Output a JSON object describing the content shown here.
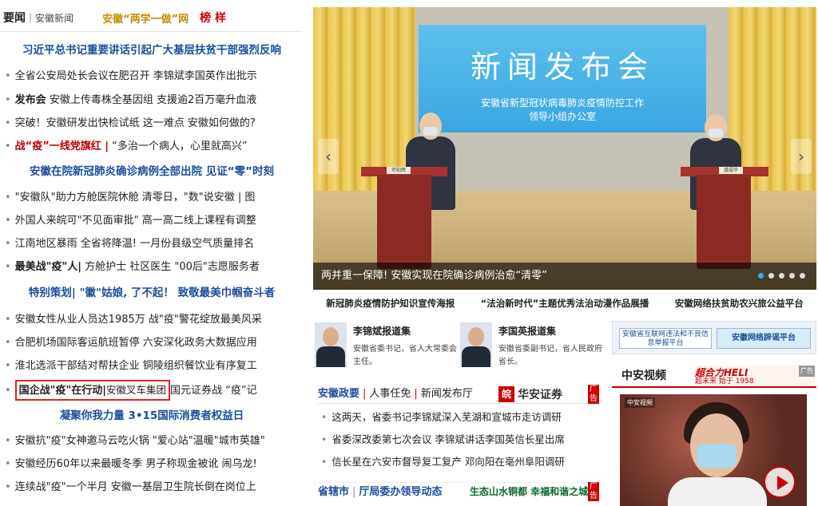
{
  "tabs": {
    "active": "要闻",
    "separator": "|",
    "second": "安徽新闻",
    "promo": "安徽“两学一做”网",
    "promo2": "榜 样"
  },
  "left": {
    "h1": "习近平总书记重要讲话引起广大基层扶贫干部强烈反响",
    "r1": "全省公安局处长会议在肥召开 李锦斌李国英作出批示",
    "r2_bold": "发布会",
    "r2_rest": " 安徽上传毒株全基因组 支援逾2百万毫升血液",
    "r3": "突破！安徽研发出快检试纸 这一难点 安徽如何做的?",
    "r4_red": "战“疫”一线党旗红 |",
    "r4_rest": " “多治一个病人，心里就高兴”",
    "h2": "安徽在院新冠肺炎确诊病例全部出院 见证“零”时刻",
    "r5": "\"安徽队\"助力方舱医院休舱 清零日，\"数\"说安徽 | 图",
    "r6": "外国人来皖可\"不见面审批\" 高一高二线上课程有调整",
    "r7": "江南地区暴雨 全省将降温! 一月份县级空气质量排名",
    "r8_bold": "最美战\"疫\"人|",
    "r8_rest": " 方舱护士 社区医生 \"00后\"志愿服务者",
    "h3": "特别策划| \"徽\"姑娘, 了不起！ 致敬最美巾帼奋斗者",
    "r9": "安徽女性从业人员达1985万 战\"疫\"警花绽放最美风采",
    "r10": "合肥机场国际客运航班暂停 六安深化政务大数据应用",
    "r11": "淮北选派干部结对帮扶企业 铜陵组织餐饮业有序复工",
    "r12_box_bold": "国企战\"疫\"在行动|",
    "r12_box_rest": "安徽叉车集团",
    "r12_rest": "国元证券战 “疫”记",
    "h4": "凝聚你我力量 3•15国际消费者权益日",
    "r13": "安徽抗\"疫\"女神邀马云吃火锅 \"爱心站\"温暖\"城市英雄\"",
    "r14": "安徽经历60年以来最暖冬季 男子称现金被讹 闹乌龙!",
    "r15": "连续战\"疫\"一个半月 安徽一基层卫生院长倒在岗位上"
  },
  "carousel": {
    "screen_title": "新闻发布会",
    "screen_sub1": "安徽省新型冠状病毒肺炎疫情防控工作",
    "screen_sub2": "领导小组办公室",
    "plate_left": "邓知辉",
    "plate_right": "虞成华",
    "caption": "两并重一保障! 安徽实现在院确诊病例治愈“清零”",
    "prev": "‹",
    "next": "›",
    "dots": 5
  },
  "features": [
    "新冠肺炎疫情防护知识宣传海报",
    "“法治新时代”主题优秀法治动漫作品展播",
    "安徽网络扶贫助农兴旅公益平台"
  ],
  "leaders": [
    {
      "name": "李锦斌报道集",
      "desc": "安徽省委书记，省人大常委会主任。"
    },
    {
      "name": "李国英报道集",
      "desc": "安徽省委副书记，省人民政府省长。"
    }
  ],
  "gov": {
    "t1": "安徽政要",
    "t2": "人事任免",
    "t3": "新闻发布厅",
    "ad_logo": "皖",
    "ad_text": "华安证券",
    "ad_tag": "广告",
    "items": [
      "这两天，省委书记李锦斌深入芜湖和宣城市走访调研",
      "省委深改委第七次会议 李锦斌讲话李国英信长星出席",
      "信长星在六安市督导复工复产 邓向阳在亳州阜阳调研"
    ],
    "b1": "省辖市",
    "b2": "厅局委办领导动态",
    "eco": "生态山水铜都  幸福和谐之城",
    "eco_tag": "广告"
  },
  "right": {
    "banner1": "安徽省互联网违法和不良信息举报平台",
    "banner2": "安徽网络辟谣平台",
    "video_title": "中安视频",
    "ad_line1": "超合力HELI",
    "ad_line2": "超未来 始于 1958",
    "ad_tag": "广告",
    "thumb_logo": "中安视频"
  }
}
